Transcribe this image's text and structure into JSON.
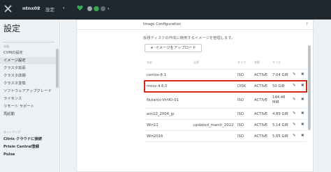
{
  "topbar": {
    "cluster_name": "ntnx02",
    "cluster_caret": "▾",
    "nav_settings": "設定",
    "nav_caret": "▾",
    "health_caret": "▾"
  },
  "sidebar": {
    "title": "設定",
    "section_general": "全般",
    "items": [
      {
        "label": "CVMの設定"
      },
      {
        "label": "イメージ設定"
      },
      {
        "label": "クラスタ拡張"
      },
      {
        "label": "クラスタ詳細"
      },
      {
        "label": "クラスタ変換"
      },
      {
        "label": "ソフトウェアアップグレード"
      },
      {
        "label": "ライセンス"
      },
      {
        "label": "リモート サポート"
      },
      {
        "label": "再起動"
      }
    ],
    "section_setup": "セットアップ",
    "setup_items": [
      {
        "label": "Citrix クラウドに接続"
      },
      {
        "label": "Prism Central登録"
      },
      {
        "label": "Pulse"
      }
    ]
  },
  "dialog": {
    "title": "Image Configuration",
    "help": "?",
    "description": "仮想ディスクの作成に使用するイメージを管理します。",
    "upload_button": "イメージをアップロード",
    "upload_plus": "+",
    "columns": {
      "name": "名前",
      "annotation": "注釈",
      "type": "タイプ",
      "state": "状態",
      "size": "サイズ"
    },
    "edit_glyph": "✎",
    "delete_glyph": "✖",
    "rows": [
      {
        "name": "centos-8.1",
        "annotation": "",
        "type": "ISO",
        "state": "ACTIVE",
        "size": "7.04 GiB"
      },
      {
        "name": "mosv-4.6.0",
        "annotation": "",
        "type": "DISK",
        "state": "ACTIVE",
        "size": "50 GiB"
      },
      {
        "name": "Nutanix-VirtIO-01",
        "annotation": "",
        "type": "ISO",
        "state": "ACTIVE",
        "size_line1": "144.46",
        "size_line2": "MiB"
      },
      {
        "name": "win10_2004_jp",
        "annotation": "",
        "type": "ISO",
        "state": "ACTIVE",
        "size": "4.89 GiB"
      },
      {
        "name": "Win11",
        "annotation": "updated_march_2022",
        "type": "ISO",
        "state": "ACTIVE",
        "size": "5.14 GiB"
      },
      {
        "name": "Win2016",
        "annotation": "",
        "type": "ISO",
        "state": "ACTIVE",
        "size": "5.65 GiB"
      }
    ],
    "highlighted_row": "mosv-4.6.0",
    "highlight_color": "#d8261e"
  },
  "colors": {
    "topbar_bg": "#20282f",
    "sidebar_bg": "#eef1f4",
    "health_green": "#35a852"
  },
  "icons": {
    "logo": "nutanix-x-icon",
    "health": "heart-icon",
    "status": "status-dot-icon"
  }
}
